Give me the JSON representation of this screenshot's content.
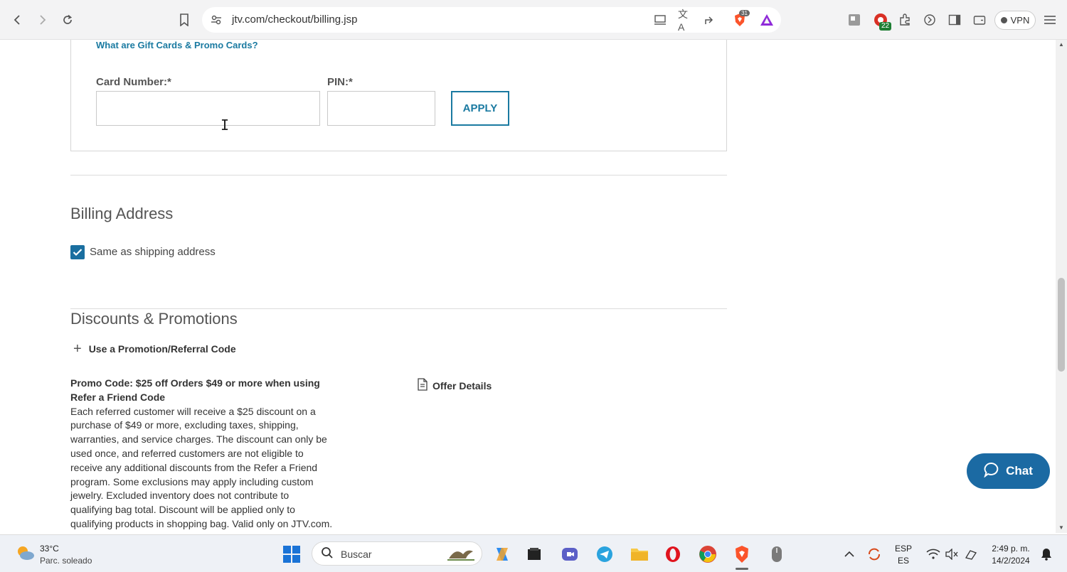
{
  "browser": {
    "url": "jtv.com/checkout/billing.jsp",
    "brave_badge": "31",
    "extension_badge": "22",
    "vpn_label": "VPN"
  },
  "gift_cards": {
    "help_link": "What are Gift Cards & Promo Cards?",
    "card_number_label": "Card Number:*",
    "card_number_value": "",
    "pin_label": "PIN:*",
    "pin_value": "",
    "apply_label": "APPLY"
  },
  "billing": {
    "title": "Billing Address",
    "same_as_shipping_label": "Same as shipping address",
    "same_as_shipping_checked": true
  },
  "discounts": {
    "title": "Discounts & Promotions",
    "toggle_label": "Use a Promotion/Referral Code",
    "promo_title": "Promo Code: $25 off Orders $49 or more when using Refer a Friend Code",
    "promo_description": "Each referred customer will receive a $25 discount on a purchase of $49 or more, excluding taxes, shipping, warranties, and service charges. The discount can only be used once, and referred customers are not eligible to receive any additional discounts from the Refer a Friend program. Some exclusions may apply including custom jewelry. Excluded inventory does not contribute to qualifying bag total. Discount will be applied only to qualifying products in shopping bag. Valid only on JTV.com.",
    "offer_details_label": "Offer Details"
  },
  "chat": {
    "label": "Chat",
    "color": "#1b6aa3"
  },
  "taskbar": {
    "weather_temp": "33°C",
    "weather_desc": "Parc. soleado",
    "search_placeholder": "Buscar",
    "lang_top": "ESP",
    "lang_bottom": "ES",
    "time": "2:49 p. m.",
    "date": "14/2/2024"
  },
  "colors": {
    "accent": "#1a7aa1",
    "checkbox": "#1a6fa0"
  }
}
